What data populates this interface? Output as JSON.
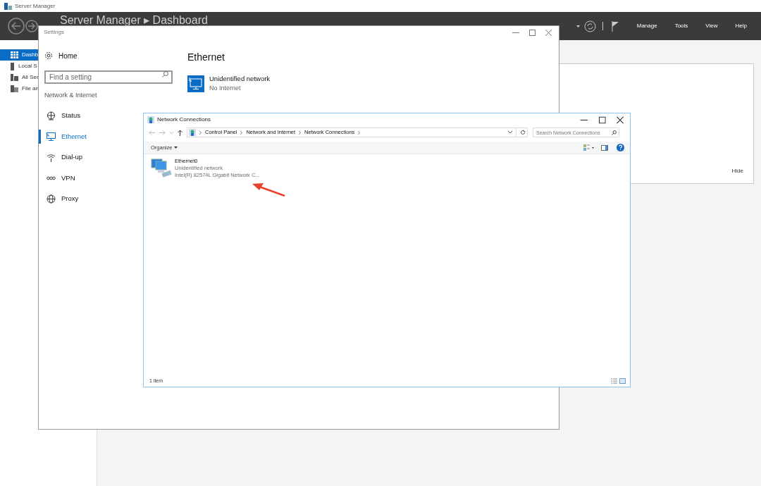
{
  "server_manager": {
    "title": "Server Manager",
    "breadcrumb": "Server Manager ▸ Dashboard",
    "menu": [
      "Manage",
      "Tools",
      "View",
      "Help"
    ],
    "nav": [
      {
        "label": "Dashb",
        "selected": true
      },
      {
        "label": "Local S",
        "selected": false
      },
      {
        "label": "All Ser",
        "selected": false
      },
      {
        "label": "File an",
        "selected": false
      }
    ],
    "panel": {
      "hide_link": "Hide"
    }
  },
  "settings": {
    "title": "Settings",
    "home": "Home",
    "search": {
      "placeholder": "Find a setting"
    },
    "section": "Network & Internet",
    "nav": [
      {
        "label": "Status",
        "selected": false
      },
      {
        "label": "Ethernet",
        "selected": true
      },
      {
        "label": "Dial-up",
        "selected": false
      },
      {
        "label": "VPN",
        "selected": false
      },
      {
        "label": "Proxy",
        "selected": false
      }
    ],
    "page_title": "Ethernet",
    "network": {
      "name": "Unidentified network",
      "status": "No Internet"
    }
  },
  "network_connections": {
    "title": "Network Connections",
    "breadcrumb": [
      "Control Panel",
      "Network and Internet",
      "Network Connections"
    ],
    "search": {
      "placeholder": "Search Network Connections"
    },
    "organize": "Organize",
    "items": [
      {
        "name": "Ethernet0",
        "status": "Unidentified network",
        "device": "Intel(R) 82574L Gigabit Network C..."
      }
    ],
    "status_bar": "1 item"
  }
}
